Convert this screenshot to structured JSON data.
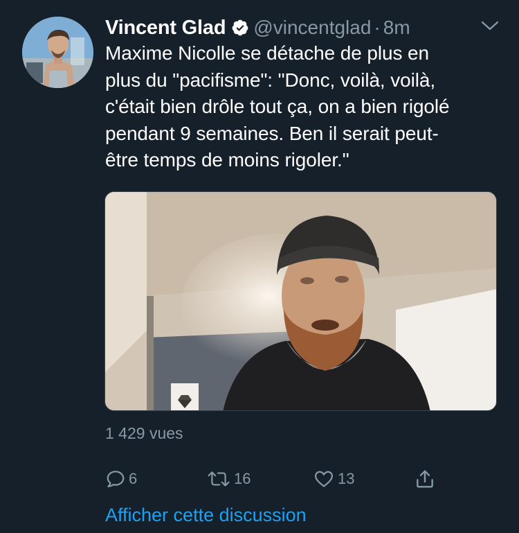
{
  "tweet": {
    "author_name": "Vincent Glad",
    "handle": "@vincentglad",
    "separator": "·",
    "time": "8m",
    "text": "Maxime Nicolle se détache de plus en\nplus du \"pacifisme\": \"Donc, voilà, voilà,\nc'était bien drôle tout ça, on a bien rigolé\npendant 9 semaines. Ben il serait peut-\nêtre temps de moins rigoler.\"",
    "views": "1 429 vues",
    "replies": "6",
    "retweets": "16",
    "likes": "13",
    "show_thread": "Afficher cette discussion"
  },
  "icons": {
    "verified": "verified-badge-icon",
    "menu": "chevron-down-icon",
    "reply": "reply-icon",
    "retweet": "retweet-icon",
    "like": "heart-icon",
    "share": "share-icon"
  },
  "colors": {
    "background": "#15202b",
    "secondary_text": "#8899a6",
    "link": "#1da1f2"
  }
}
